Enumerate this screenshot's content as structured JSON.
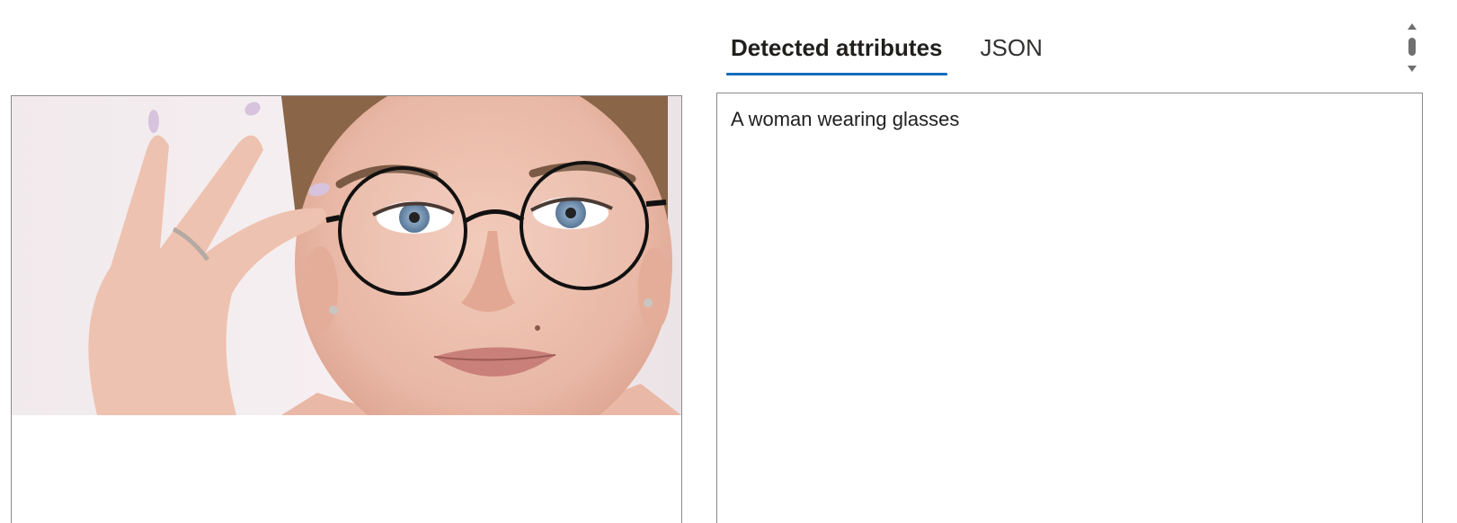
{
  "tabs": [
    {
      "label": "Detected attributes",
      "active": true
    },
    {
      "label": "JSON",
      "active": false
    }
  ],
  "result": {
    "text": "A woman wearing glasses"
  },
  "image": {
    "alt": "A woman wearing glasses"
  },
  "colors": {
    "accent": "#0f6cbd",
    "border": "#8a8a8a",
    "scrollbar": "#707070"
  },
  "icons": {
    "scroll_up": "scroll-up-arrow-icon",
    "scroll_down": "scroll-down-arrow-icon"
  }
}
